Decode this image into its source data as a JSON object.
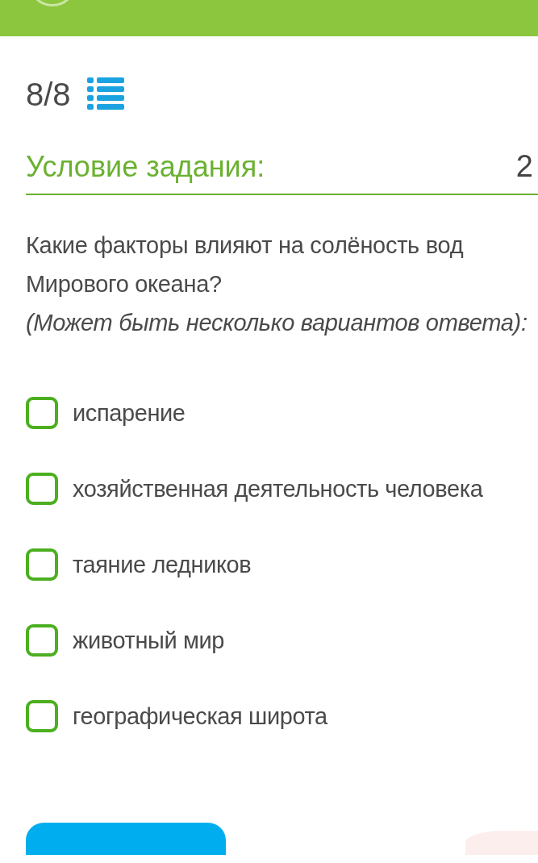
{
  "progress": {
    "counter": "8/8"
  },
  "task": {
    "heading": "Условие задания:",
    "points": "2",
    "question": "Какие факторы влияют на солёность вод Мирового океана?",
    "hint": "(Может быть несколько вариантов ответа):"
  },
  "options": [
    {
      "label": "испарение",
      "checked": false
    },
    {
      "label": "хозяйственная деятельность человека",
      "checked": false
    },
    {
      "label": "таяние ледников",
      "checked": false
    },
    {
      "label": "животный мир",
      "checked": false
    },
    {
      "label": "географическая широта",
      "checked": false
    }
  ]
}
